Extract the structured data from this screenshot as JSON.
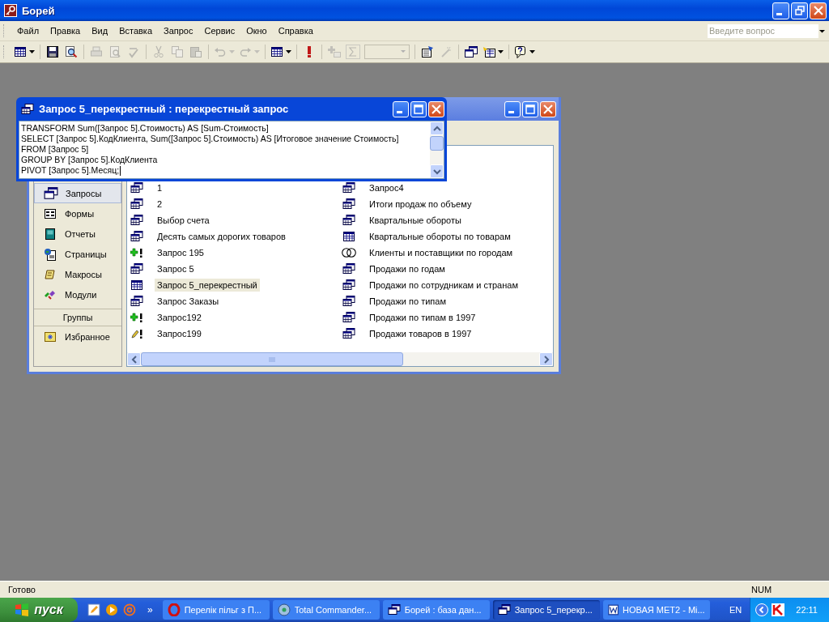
{
  "window": {
    "title": "Борей"
  },
  "menu": [
    "Файл",
    "Правка",
    "Вид",
    "Вставка",
    "Запрос",
    "Сервис",
    "Окно",
    "Справка"
  ],
  "help_box": {
    "placeholder": "Введите вопрос"
  },
  "toolbar": [
    {
      "kind": "view",
      "disabled": false,
      "caret": true
    },
    {
      "kind": "separator"
    },
    {
      "kind": "save",
      "disabled": false,
      "caret": false
    },
    {
      "kind": "find",
      "disabled": false,
      "caret": false
    },
    {
      "kind": "separator"
    },
    {
      "kind": "print",
      "disabled": true,
      "caret": false
    },
    {
      "kind": "preview",
      "disabled": true,
      "caret": false
    },
    {
      "kind": "spelling",
      "disabled": true,
      "caret": false
    },
    {
      "kind": "separator"
    },
    {
      "kind": "cut",
      "disabled": true,
      "caret": false
    },
    {
      "kind": "copy",
      "disabled": true,
      "caret": false
    },
    {
      "kind": "paste",
      "disabled": true,
      "caret": false
    },
    {
      "kind": "separator"
    },
    {
      "kind": "undo",
      "disabled": true,
      "caret": true
    },
    {
      "kind": "redo",
      "disabled": true,
      "caret": true
    },
    {
      "kind": "separator"
    },
    {
      "kind": "querytype",
      "disabled": false,
      "caret": true
    },
    {
      "kind": "separator"
    },
    {
      "kind": "run",
      "disabled": false,
      "caret": false
    },
    {
      "kind": "separator"
    },
    {
      "kind": "addtable",
      "disabled": true,
      "caret": false
    },
    {
      "kind": "totals",
      "disabled": true,
      "caret": false
    },
    {
      "kind": "combo",
      "disabled": true,
      "caret": true
    },
    {
      "kind": "separator"
    },
    {
      "kind": "properties",
      "disabled": false,
      "caret": false
    },
    {
      "kind": "build",
      "disabled": true,
      "caret": false
    },
    {
      "kind": "separator"
    },
    {
      "kind": "dbwindow",
      "disabled": false,
      "caret": false
    },
    {
      "kind": "newobject",
      "disabled": false,
      "caret": true
    },
    {
      "kind": "separator"
    },
    {
      "kind": "help",
      "disabled": false,
      "caret": true
    }
  ],
  "query_window": {
    "title": "Запрос 5_перекрестный : перекрестный запрос",
    "sql_lines": [
      "TRANSFORM Sum([Запрос 5].Стоимость) AS [Sum-Стоимость]",
      "SELECT [Запрос 5].КодКлиента, Sum([Запрос 5].Стоимость) AS [Итоговое значение Стоимость]",
      "FROM [Запрос 5]",
      "GROUP BY [Запрос 5].КодКлиента",
      "PIVOT [Запрос 5].Месяц;"
    ]
  },
  "database_window": {
    "objects": [
      {
        "label": "Запросы",
        "kind": "queries",
        "selected": true
      },
      {
        "label": "Формы",
        "kind": "forms",
        "selected": false
      },
      {
        "label": "Отчеты",
        "kind": "reports",
        "selected": false
      },
      {
        "label": "Страницы",
        "kind": "pages",
        "selected": false
      },
      {
        "label": "Макросы",
        "kind": "macros",
        "selected": false
      },
      {
        "label": "Модули",
        "kind": "modules",
        "selected": false
      }
    ],
    "groups_header": "Группы",
    "groups": [
      {
        "label": "Избранное",
        "selected": false
      }
    ],
    "columns": [
      [
        {
          "name": "1",
          "kind": "select",
          "selected": false
        },
        {
          "name": "2",
          "kind": "select",
          "selected": false
        },
        {
          "name": "Выбор счета",
          "kind": "select",
          "selected": false
        },
        {
          "name": "Десять самых дорогих товаров",
          "kind": "select",
          "selected": false
        },
        {
          "name": "Запрос 195",
          "kind": "append",
          "selected": false
        },
        {
          "name": "Запрос 5",
          "kind": "select",
          "selected": false
        },
        {
          "name": "Запрос 5_перекрестный",
          "kind": "crosstab",
          "selected": true
        },
        {
          "name": "Запрос Заказы",
          "kind": "select",
          "selected": false
        },
        {
          "name": "Запрос192",
          "kind": "append",
          "selected": false
        },
        {
          "name": "Запрос199",
          "kind": "update",
          "selected": false
        }
      ],
      [
        {
          "name": "Запрос4",
          "kind": "select",
          "selected": false
        },
        {
          "name": "Итоги продаж по объему",
          "kind": "select",
          "selected": false
        },
        {
          "name": "Квартальные обороты",
          "kind": "select",
          "selected": false
        },
        {
          "name": "Квартальные обороты по товарам",
          "kind": "crosstab",
          "selected": false
        },
        {
          "name": "Клиенты и поставщики по городам",
          "kind": "union",
          "selected": false
        },
        {
          "name": "Продажи по годам",
          "kind": "select",
          "selected": false
        },
        {
          "name": "Продажи по сотрудникам и странам",
          "kind": "select",
          "selected": false
        },
        {
          "name": "Продажи по типам",
          "kind": "select",
          "selected": false
        },
        {
          "name": "Продажи по типам в 1997",
          "kind": "select",
          "selected": false
        },
        {
          "name": "Продажи товаров в 1997",
          "kind": "select",
          "selected": false
        }
      ]
    ]
  },
  "status_bar": {
    "text": "Готово",
    "indicator": "NUM"
  },
  "taskbar": {
    "start": "пуск",
    "tasks": [
      {
        "label": "Перелік пільг з П...",
        "kind": "opera",
        "selected": false
      },
      {
        "label": "Total Commander...",
        "kind": "commander",
        "selected": false
      },
      {
        "label": "Борей : база дан...",
        "kind": "database",
        "selected": false
      },
      {
        "label": "Запрос 5_перекр...",
        "kind": "query",
        "selected": true
      },
      {
        "label": "НОВАЯ МЕТ2 - Mi...",
        "kind": "word",
        "selected": false
      }
    ],
    "more": "»",
    "language": "EN",
    "clock": "22:11"
  }
}
